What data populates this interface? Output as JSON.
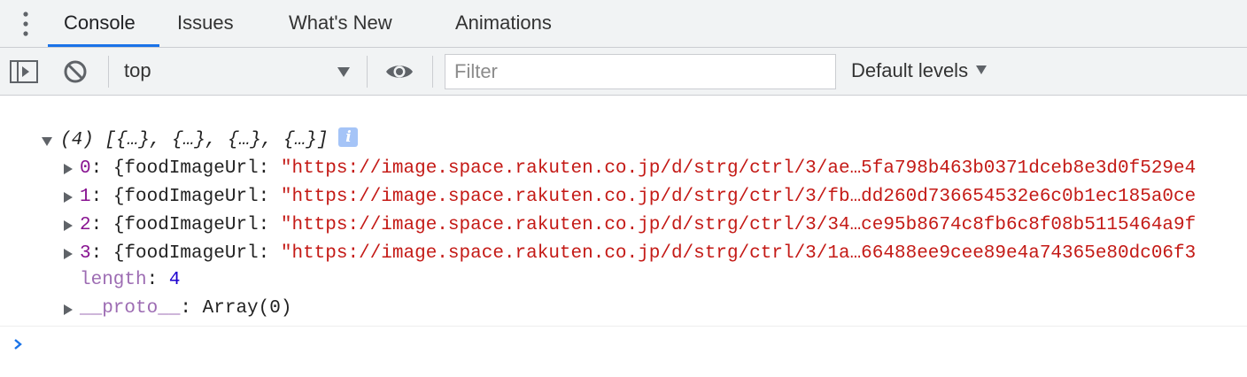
{
  "tabs": {
    "menu_icon": "kebab-menu-icon",
    "items": [
      {
        "label": "Console",
        "active": true
      },
      {
        "label": "Issues",
        "active": false
      },
      {
        "label": "What's New",
        "active": false
      },
      {
        "label": "Animations",
        "active": false
      }
    ],
    "accent_color": "#1a73e8"
  },
  "toolbar": {
    "sidebar_icon": "sidebar-toggle-icon",
    "clear_icon": "clear-console-icon",
    "context": "top",
    "eye_icon": "live-expression-eye-icon",
    "filter_placeholder": "Filter",
    "filter_value": "",
    "levels_label": "Default levels"
  },
  "console": {
    "summary": "(4) [{…}, {…}, {…}, {…}]",
    "info_icon": "i",
    "entries": [
      {
        "index": "0",
        "key": "foodImageUrl",
        "value": "\"https://image.space.rakuten.co.jp/d/strg/ctrl/3/ae…5fa798b463b0371dceb8e3d0f529e4"
      },
      {
        "index": "1",
        "key": "foodImageUrl",
        "value": "\"https://image.space.rakuten.co.jp/d/strg/ctrl/3/fb…dd260d736654532e6c0b1ec185a0ce"
      },
      {
        "index": "2",
        "key": "foodImageUrl",
        "value": "\"https://image.space.rakuten.co.jp/d/strg/ctrl/3/34…ce95b8674c8fb6c8f08b5115464a9f"
      },
      {
        "index": "3",
        "key": "foodImageUrl",
        "value": "\"https://image.space.rakuten.co.jp/d/strg/ctrl/3/1a…66488ee9cee89e4a74365e80dc06f3"
      }
    ],
    "length_key": "length",
    "length_value": "4",
    "proto_key": "__proto__",
    "proto_value": "Array(0)",
    "colors": {
      "index": "#881391",
      "property": "#9d6cb3",
      "string": "#c41a16",
      "number": "#1c00cf",
      "prompt": "#1a73e8"
    }
  }
}
